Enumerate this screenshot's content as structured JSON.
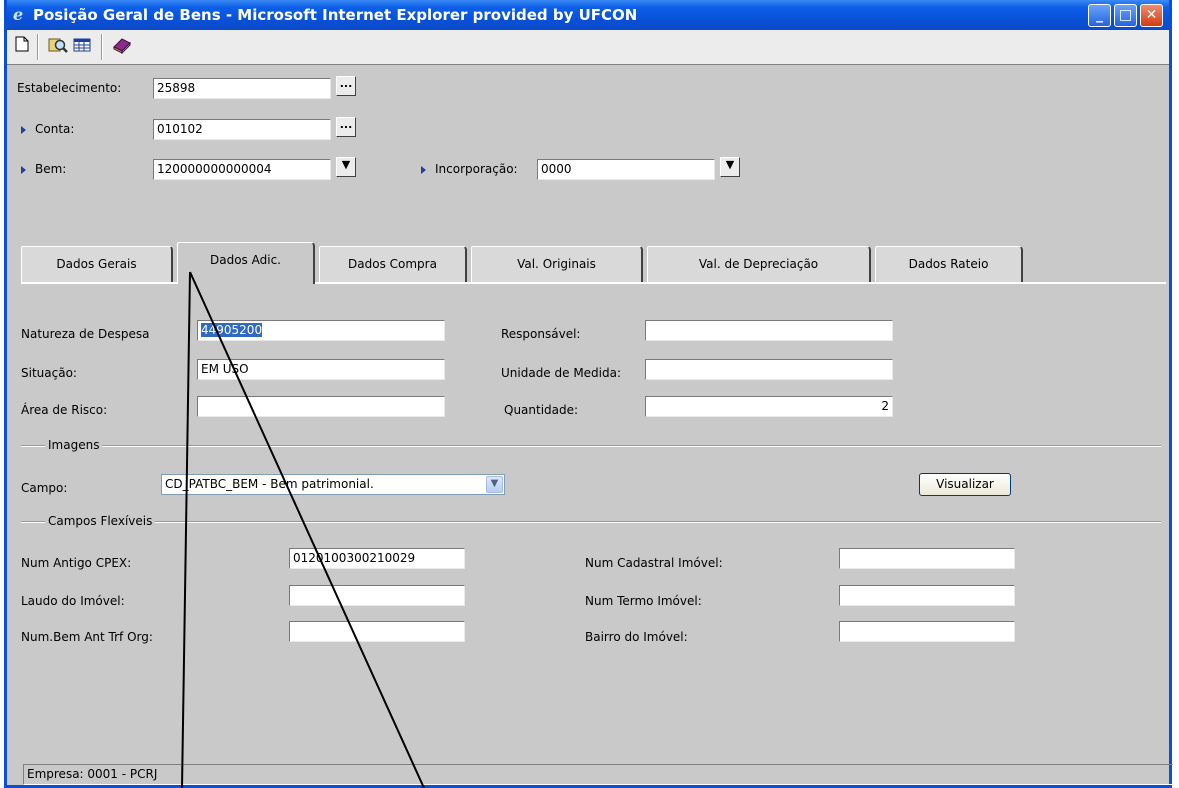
{
  "window": {
    "title": "Posição Geral de Bens - Microsoft Internet Explorer provided by UFCON",
    "tooltip": "Posição Geral de Bens - Microsoft Internet Explorer provided by U",
    "minimize": "_",
    "maximize": "□",
    "close": "✕"
  },
  "toolbar": {
    "icons": [
      "new-document-icon",
      "search-icon",
      "table-icon",
      "book-icon"
    ]
  },
  "header": {
    "estabelecimento_label": "Estabelecimento:",
    "estabelecimento_value": "25898",
    "conta_label": "Conta:",
    "conta_value": "010102",
    "bem_label": "Bem:",
    "bem_value": "120000000000004",
    "incorporacao_label": "Incorporação:",
    "incorporacao_value": "0000",
    "lookup_btn": "...",
    "dropdown_btn": "▼"
  },
  "tabs": [
    {
      "label": "Dados Gerais"
    },
    {
      "label": "Dados Adic."
    },
    {
      "label": "Dados Compra"
    },
    {
      "label": "Val. Originais"
    },
    {
      "label": "Val. de Depreciação"
    },
    {
      "label": "Dados Rateio"
    }
  ],
  "dados_adic": {
    "natureza_label": "Natureza de Despesa",
    "natureza_value": "44905200",
    "situacao_label": "Situação:",
    "situacao_value": "EM USO",
    "area_label": "Área de Risco:",
    "area_value": "",
    "responsavel_label": "Responsável:",
    "responsavel_value": "",
    "unidade_label": "Unidade de Medida:",
    "unidade_value": "",
    "quantidade_label": "Quantidade:",
    "quantidade_value": "2"
  },
  "imagens": {
    "group_title": "Imagens",
    "campo_label": "Campo:",
    "campo_value": "CD_PATBC_BEM - Bem patrimonial.",
    "visualizar_label": "Visualizar"
  },
  "flex": {
    "group_title": "Campos Flexíveis",
    "num_antigo_label": "Num Antigo CPEX:",
    "num_antigo_value": "0120100300210029",
    "laudo_label": "Laudo do Imóvel:",
    "laudo_value": "",
    "num_bem_label": "Num.Bem Ant Trf Org:",
    "num_bem_value": "",
    "num_cadastral_label": "Num Cadastral Imóvel:",
    "num_cadastral_value": "",
    "num_termo_label": "Num Termo Imóvel:",
    "num_termo_value": "",
    "bairro_label": "Bairro do Imóvel:",
    "bairro_value": ""
  },
  "status": {
    "text": "Empresa: 0001 - PCRJ"
  }
}
